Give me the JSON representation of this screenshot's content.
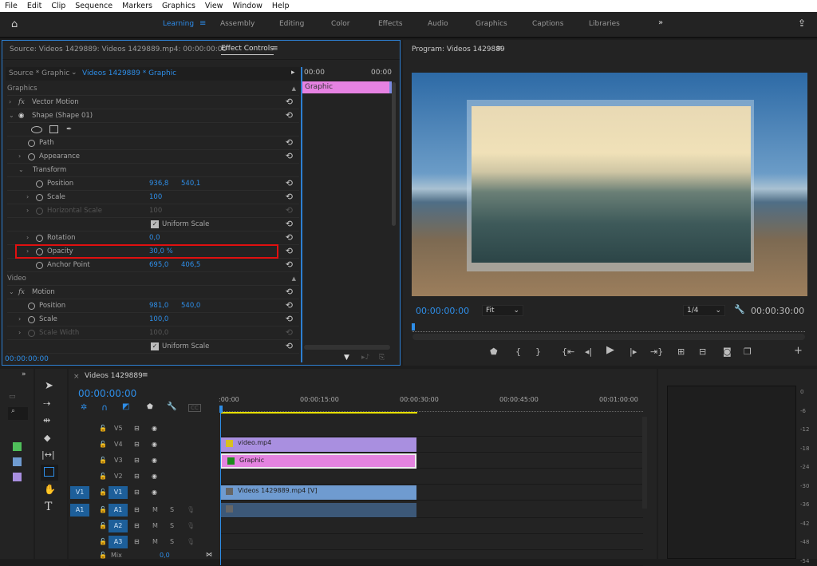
{
  "menu": [
    "File",
    "Edit",
    "Clip",
    "Sequence",
    "Markers",
    "Graphics",
    "View",
    "Window",
    "Help"
  ],
  "workspaces": [
    "Learning",
    "Assembly",
    "Editing",
    "Color",
    "Effects",
    "Audio",
    "Graphics",
    "Captions",
    "Libraries"
  ],
  "active_workspace": "Learning",
  "icons": {
    "home": "home-icon",
    "share": "share-icon",
    "more": "chevron-double-right-icon"
  },
  "effect_controls": {
    "source_tab": "Source: Videos 1429889: Videos 1429889.mp4: 00:00:00:00",
    "tab": "Effect Controls",
    "source_clip": "Source * Graphic",
    "sequence_clip": "Videos 1429889 * Graphic",
    "mini_ruler_start": "00:00",
    "mini_ruler_end": "00:00",
    "mini_clip": "Graphic",
    "timecode": "00:00:00:00",
    "rows": [
      {
        "label": "Graphics",
        "type": "section"
      },
      {
        "label": "Vector Motion",
        "type": "fx",
        "chev": ">"
      },
      {
        "label": "Shape (Shape 01)",
        "type": "eye",
        "chev": "v"
      },
      {
        "label": "",
        "type": "shapes"
      },
      {
        "label": "Path",
        "type": "prop",
        "indent": 1
      },
      {
        "label": "Appearance",
        "type": "prop",
        "indent": 1,
        "chev": ">"
      },
      {
        "label": "Transform",
        "type": "plain",
        "indent": 1,
        "chev": "v"
      },
      {
        "label": "Position",
        "type": "prop",
        "indent": 2,
        "v1": "936,8",
        "v2": "540,1"
      },
      {
        "label": "Scale",
        "type": "prop",
        "indent": 2,
        "chev": ">",
        "v1": "100"
      },
      {
        "label": "Horizontal Scale",
        "type": "prop",
        "indent": 2,
        "chev": ">",
        "v1": "100",
        "disabled": true
      },
      {
        "label": "Uniform Scale",
        "type": "check"
      },
      {
        "label": "Rotation",
        "type": "prop",
        "indent": 2,
        "chev": ">",
        "v1": "0,0"
      },
      {
        "label": "Opacity",
        "type": "prop",
        "indent": 2,
        "chev": ">",
        "v1": "30,0 %",
        "highlight": true
      },
      {
        "label": "Anchor Point",
        "type": "prop",
        "indent": 2,
        "v1": "695,0",
        "v2": "406,5"
      },
      {
        "label": "Video",
        "type": "section"
      },
      {
        "label": "Motion",
        "type": "fx",
        "chev": "v"
      },
      {
        "label": "Position",
        "type": "prop",
        "indent": 1,
        "v1": "981,0",
        "v2": "540,0"
      },
      {
        "label": "Scale",
        "type": "prop",
        "indent": 1,
        "chev": ">",
        "v1": "100,0"
      },
      {
        "label": "Scale Width",
        "type": "prop",
        "indent": 1,
        "chev": ">",
        "v1": "100,0",
        "disabled": true
      },
      {
        "label": "Uniform Scale",
        "type": "check"
      }
    ]
  },
  "program": {
    "title": "Program: Videos 1429889",
    "timecode": "00:00:00:00",
    "fit": "Fit",
    "resolution": "1/4",
    "duration": "00:00:30:00"
  },
  "timeline": {
    "title": "Videos 1429889",
    "timecode": "00:00:00:00",
    "ruler": [
      ":00:00",
      "00:00:15:00",
      "00:00:30:00",
      "00:00:45:00",
      "00:01:00:00"
    ],
    "tracks": [
      {
        "name": "V5"
      },
      {
        "name": "V4"
      },
      {
        "name": "V3"
      },
      {
        "name": "V2"
      },
      {
        "name": "V1",
        "src": "V1"
      },
      {
        "name": "A1",
        "src": "A1",
        "audio": true
      },
      {
        "name": "A2",
        "audio": true
      },
      {
        "name": "A3",
        "audio": true
      }
    ],
    "mix_label": "Mix",
    "mix_value": "0,0",
    "m": "M",
    "s": "S",
    "clips": [
      {
        "label": "video.mp4",
        "color": "#a98fe0",
        "track": 1
      },
      {
        "label": "Graphic",
        "color": "#e483e0",
        "track": 2
      },
      {
        "label": "Videos 1429889.mp4 [V]",
        "color": "#6f9bd0",
        "track": 4
      },
      {
        "label": "",
        "color": "#3c5878",
        "track": 5
      }
    ],
    "label_colors": [
      "#4fbf5a",
      "#6f9bd0",
      "#a98fe0"
    ]
  },
  "meters": {
    "scale": [
      "0",
      "-6",
      "-12",
      "-18",
      "-24",
      "-30",
      "-36",
      "-42",
      "-48",
      "-54"
    ]
  }
}
